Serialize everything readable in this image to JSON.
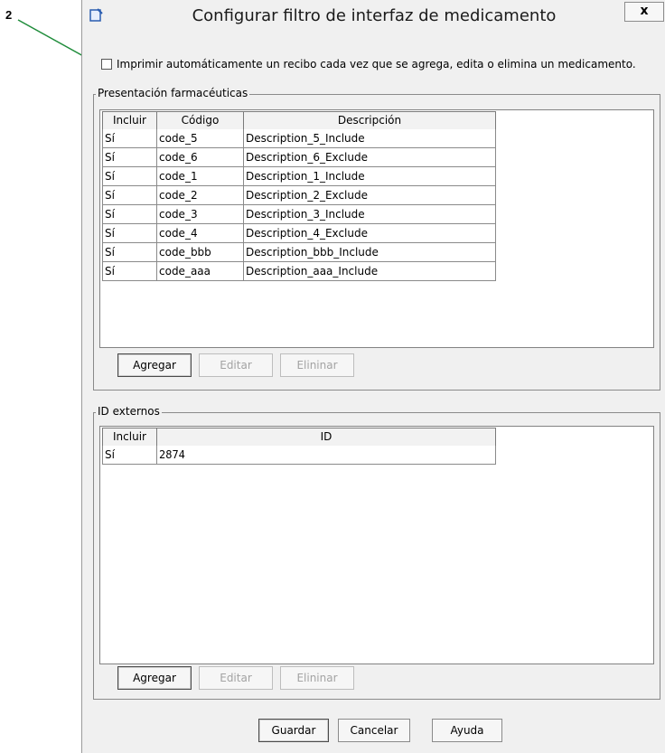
{
  "callout": {
    "number": "2"
  },
  "dialog": {
    "title": "Configurar filtro de interfaz de medicamento",
    "close_label": "x",
    "auto_print": {
      "checked": false,
      "label": "Imprimir automáticamente un recibo cada vez que se agrega, edita o elimina un medicamento."
    },
    "presentations": {
      "legend": "Presentación farmacéuticas",
      "columns": [
        "Incluir",
        "Código",
        "Descripción"
      ],
      "rows": [
        [
          "Sí",
          "code_5",
          "Description_5_Include"
        ],
        [
          "Sí",
          "code_6",
          "Description_6_Exclude"
        ],
        [
          "Sí",
          "code_1",
          "Description_1_Include"
        ],
        [
          "Sí",
          "code_2",
          "Description_2_Exclude"
        ],
        [
          "Sí",
          "code_3",
          "Description_3_Include"
        ],
        [
          "Sí",
          "code_4",
          "Description_4_Exclude"
        ],
        [
          "Sí",
          "code_bbb",
          "Description_bbb_Include"
        ],
        [
          "Sí",
          "code_aaa",
          "Description_aaa_Include"
        ]
      ],
      "buttons": {
        "add": "Agregar",
        "edit": "Editar",
        "delete": "Elininar"
      }
    },
    "external_ids": {
      "legend": "ID externos",
      "columns": [
        "Incluir",
        "ID"
      ],
      "rows": [
        [
          "Sí",
          "2874"
        ]
      ],
      "buttons": {
        "add": "Agregar",
        "edit": "Editar",
        "delete": "Elininar"
      }
    },
    "footer": {
      "save": "Guardar",
      "cancel": "Cancelar",
      "help": "Ayuda"
    }
  }
}
